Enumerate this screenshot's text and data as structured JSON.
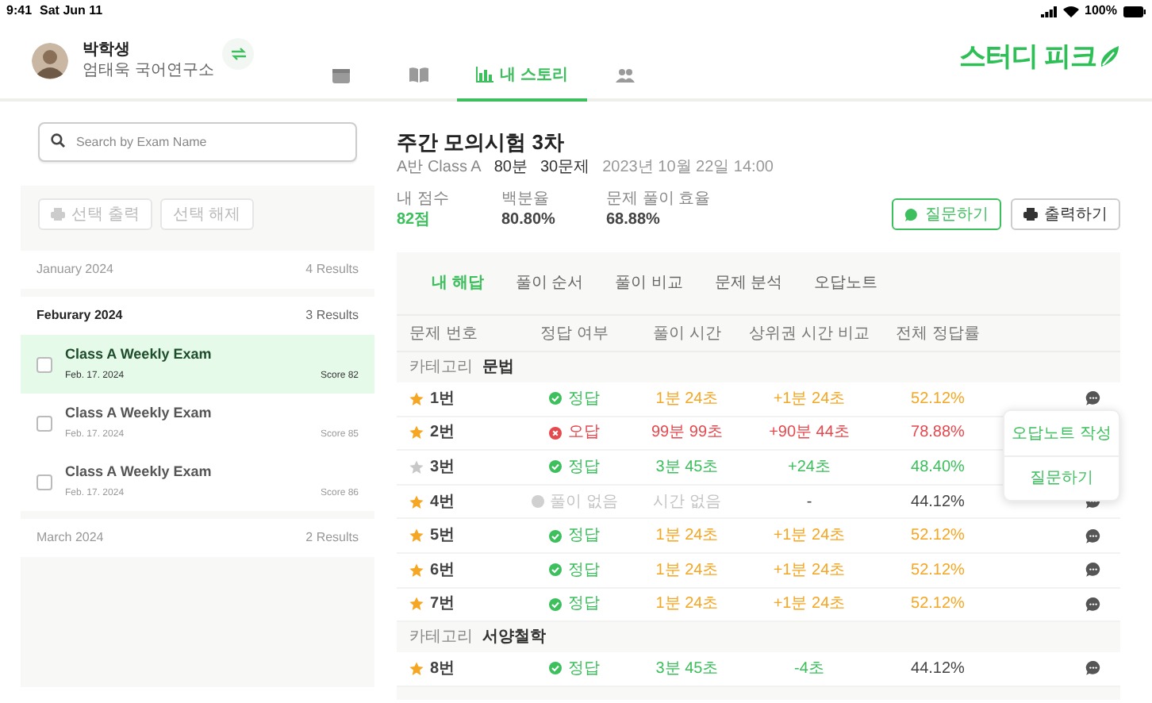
{
  "status_bar": {
    "time": "9:41",
    "date": "Sat Jun 11",
    "battery": "100%"
  },
  "profile": {
    "name": "박학생",
    "organization": "엄태욱 국어연구소"
  },
  "nav_tabs": [
    {
      "kind": "calendar",
      "selected": false
    },
    {
      "kind": "book",
      "selected": false
    },
    {
      "kind": "chart",
      "label": "내 스토리",
      "selected": true
    },
    {
      "kind": "people",
      "selected": false
    }
  ],
  "logo": "스터디 피크",
  "search": {
    "placeholder": "Search by Exam Name"
  },
  "bulk_actions": [
    {
      "kind": "print",
      "label": "선택 출력",
      "disabled": true
    },
    {
      "kind": "clear",
      "label": "선택 해제",
      "disabled": true
    }
  ],
  "exam_months": [
    {
      "label": "January 2024",
      "count": "4 Results",
      "expanded": false
    },
    {
      "label": "Feburary 2024",
      "count": "3 Results",
      "expanded": true,
      "exams": [
        {
          "title": "Class A Weekly Exam",
          "date": "Feb. 17. 2024",
          "score": "Score 82",
          "selected": true,
          "checked": false
        },
        {
          "title": "Class A Weekly Exam",
          "date": "Feb. 17. 2024",
          "score": "Score 85",
          "selected": false,
          "checked": false
        },
        {
          "title": "Class A Weekly Exam",
          "date": "Feb. 17. 2024",
          "score": "Score 86",
          "selected": false,
          "checked": false
        }
      ]
    },
    {
      "label": "March 2024",
      "count": "2 Results",
      "expanded": false
    }
  ],
  "exam": {
    "title": "주간 모의시험 3차",
    "class": "A반 Class A",
    "duration": "80분",
    "questions": "30문제",
    "datetime": "2023년 10월 22일 14:00",
    "stats": [
      {
        "label": "내 점수",
        "value": "82점",
        "highlight": true
      },
      {
        "label": "백분율",
        "value": "80.80%",
        "highlight": false
      },
      {
        "label": "문제 풀이 효율",
        "value": "68.88%",
        "highlight": false
      }
    ]
  },
  "actions": [
    {
      "kind": "ask",
      "label": "질문하기"
    },
    {
      "kind": "print",
      "label": "출력하기"
    }
  ],
  "result_tabs": [
    {
      "label": "내 해답",
      "selected": true
    },
    {
      "label": "풀이 순서",
      "selected": false
    },
    {
      "label": "풀이 비교",
      "selected": false
    },
    {
      "label": "문제 분석",
      "selected": false
    },
    {
      "label": "오답노트",
      "selected": false
    }
  ],
  "table": {
    "columns": [
      "문제 번호",
      "정답 여부",
      "풀이 시간",
      "상위권 시간 비교",
      "전체 정답률"
    ],
    "groups": [
      {
        "category_label": "카테고리",
        "category": "문법",
        "rows": [
          {
            "number": "1번",
            "starred": true,
            "result": {
              "kind": "correct",
              "label": "정답"
            },
            "time": {
              "text": "1분 24초",
              "color": "#f5a623"
            },
            "compare": {
              "text": "+1분 24초",
              "color": "#f5a623"
            },
            "rate": {
              "text": "52.12%",
              "color": "#f5a623"
            },
            "comment_icon": true
          },
          {
            "number": "2번",
            "starred": true,
            "result": {
              "kind": "wrong",
              "label": "오답"
            },
            "time": {
              "text": "99분 99초",
              "color": "#e5484d"
            },
            "compare": {
              "text": "+90분 44초",
              "color": "#e5484d"
            },
            "rate": {
              "text": "78.88%",
              "color": "#e5484d"
            },
            "comment_icon": false
          },
          {
            "number": "3번",
            "starred": false,
            "result": {
              "kind": "correct",
              "label": "정답"
            },
            "time": {
              "text": "3분 45초",
              "color": "#3cbf5c"
            },
            "compare": {
              "text": "+24초",
              "color": "#3cbf5c"
            },
            "rate": {
              "text": "48.40%",
              "color": "#3cbf5c"
            },
            "comment_icon": false
          },
          {
            "number": "4번",
            "starred": true,
            "result": {
              "kind": "none",
              "label": "풀이 없음"
            },
            "time": {
              "text": "시간 없음",
              "color": "#c4c4c4"
            },
            "compare": {
              "text": "-",
              "color": "#444444"
            },
            "rate": {
              "text": "44.12%",
              "color": "#444444"
            },
            "comment_icon": true
          },
          {
            "number": "5번",
            "starred": true,
            "result": {
              "kind": "correct",
              "label": "정답"
            },
            "time": {
              "text": "1분 24초",
              "color": "#f5a623"
            },
            "compare": {
              "text": "+1분 24초",
              "color": "#f5a623"
            },
            "rate": {
              "text": "52.12%",
              "color": "#f5a623"
            },
            "comment_icon": true
          },
          {
            "number": "6번",
            "starred": true,
            "result": {
              "kind": "correct",
              "label": "정답"
            },
            "time": {
              "text": "1분 24초",
              "color": "#f5a623"
            },
            "compare": {
              "text": "+1분 24초",
              "color": "#f5a623"
            },
            "rate": {
              "text": "52.12%",
              "color": "#f5a623"
            },
            "comment_icon": true
          },
          {
            "number": "7번",
            "starred": true,
            "result": {
              "kind": "correct",
              "label": "정답"
            },
            "time": {
              "text": "1분 24초",
              "color": "#f5a623"
            },
            "compare": {
              "text": "+1분 24초",
              "color": "#f5a623"
            },
            "rate": {
              "text": "52.12%",
              "color": "#f5a623"
            },
            "comment_icon": true
          }
        ]
      },
      {
        "category_label": "카테고리",
        "category": "서양철학",
        "rows": [
          {
            "number": "8번",
            "starred": true,
            "result": {
              "kind": "correct",
              "label": "정답"
            },
            "time": {
              "text": "3분 45초",
              "color": "#3cbf5c"
            },
            "compare": {
              "text": "-4초",
              "color": "#3cbf5c"
            },
            "rate": {
              "text": "44.12%",
              "color": "#444444"
            },
            "comment_icon": true
          }
        ]
      }
    ]
  },
  "popup_menu": {
    "items": [
      "오답노트 작성",
      "질문하기"
    ]
  }
}
